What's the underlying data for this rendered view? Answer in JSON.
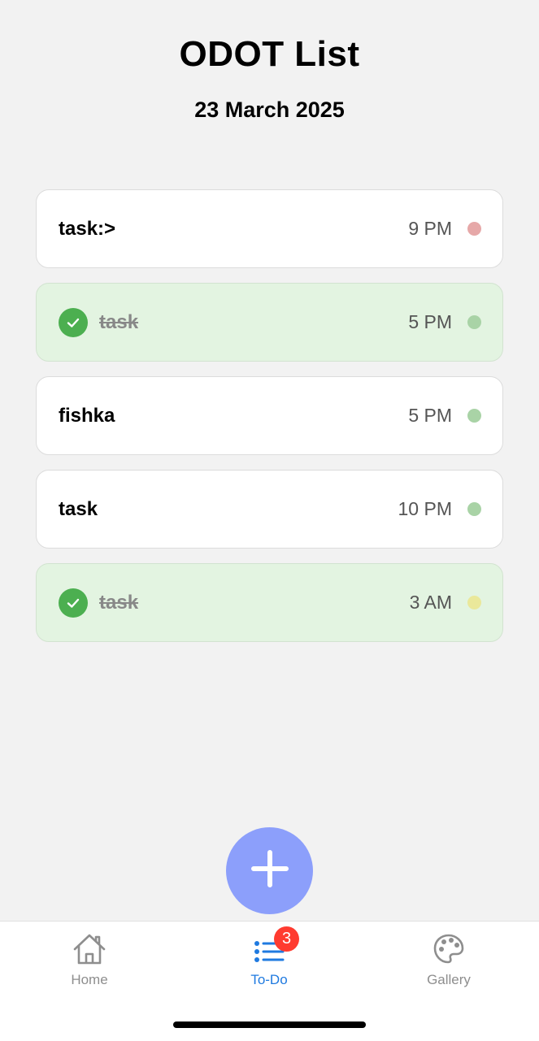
{
  "header": {
    "title": "ODOT List",
    "date": "23 March 2025"
  },
  "tasks": [
    {
      "name": "task:>",
      "time": "9 PM",
      "done": false,
      "dot_color": "#e6a8a8"
    },
    {
      "name": "task",
      "time": "5 PM",
      "done": true,
      "dot_color": "#a9d3a6"
    },
    {
      "name": "fishka",
      "time": "5 PM",
      "done": false,
      "dot_color": "#a9d3a6"
    },
    {
      "name": "task",
      "time": "10 PM",
      "done": false,
      "dot_color": "#a9d3a6"
    },
    {
      "name": "task",
      "time": "3 AM",
      "done": true,
      "dot_color": "#eae89a"
    }
  ],
  "fab": {
    "icon": "plus-icon",
    "color": "#8c9ffb"
  },
  "tabbar": {
    "items": [
      {
        "label": "Home",
        "icon": "home-icon",
        "active": false
      },
      {
        "label": "To-Do",
        "icon": "list-icon",
        "active": true,
        "badge": "3"
      },
      {
        "label": "Gallery",
        "icon": "palette-icon",
        "active": false
      }
    ]
  },
  "colors": {
    "accent": "#1f7ae0",
    "done_background": "#e3f4e1",
    "check": "#4caf50",
    "badge": "#ff3b30"
  }
}
